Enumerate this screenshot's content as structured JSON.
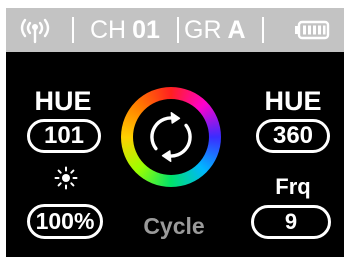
{
  "status_bar": {
    "signal_icon": "antenna-signal-icon",
    "channel_label": "CH",
    "channel_value": "01",
    "group_label": "GR",
    "group_value": "A",
    "battery_icon": "battery-full-icon",
    "background_color": "#c3c3c3"
  },
  "left_panel": {
    "hue_label": "HUE",
    "hue_value": "101",
    "brightness_icon": "sun-brightness-icon",
    "brightness_value": "100%"
  },
  "center": {
    "cycle_icon": "cycle-arrows-icon",
    "cycle_label": "Cycle",
    "ring_colors": [
      "#ff2020",
      "#ff00cc",
      "#3a2cff",
      "#00b7ff",
      "#00e26a",
      "#9cff00",
      "#ffd000",
      "#ff7a00"
    ]
  },
  "right_panel": {
    "hue_label": "HUE",
    "hue_value": "360",
    "frequency_label": "Frq",
    "frequency_value": "9"
  }
}
